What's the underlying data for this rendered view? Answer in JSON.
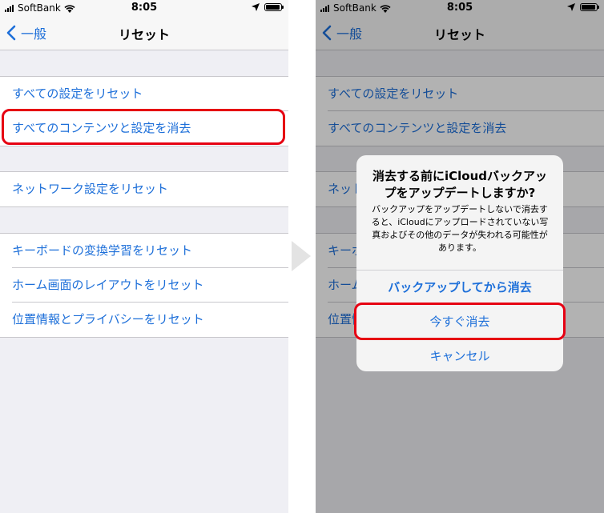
{
  "status_bar": {
    "carrier": "SoftBank",
    "time": "8:05"
  },
  "nav": {
    "back_label": "一般",
    "title": "リセット"
  },
  "reset_groups": [
    [
      "すべての設定をリセット",
      "すべてのコンテンツと設定を消去"
    ],
    [
      "ネットワーク設定をリセット"
    ],
    [
      "キーボードの変換学習をリセット",
      "ホーム画面のレイアウトをリセット",
      "位置情報とプライバシーをリセット"
    ]
  ],
  "alert": {
    "title": "消去する前にiCloudバックアップをアップデートしますか?",
    "message": "バックアップをアップデートしないで消去すると、iCloudにアップロードされていない写真およびその他のデータが失われる可能性があります。",
    "buttons": [
      "バックアップしてから消去",
      "今すぐ消去",
      "キャンセル"
    ]
  },
  "colors": {
    "link_blue": "#1d6fd9",
    "highlight_red": "#e60012",
    "group_bg": "#efeff4"
  }
}
